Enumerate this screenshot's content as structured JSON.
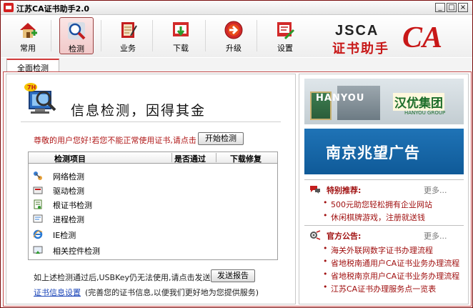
{
  "window": {
    "title": "江苏CA证书助手2.0",
    "controls": [
      "_",
      "□",
      "×"
    ]
  },
  "toolbar": {
    "items": [
      {
        "label": "常用",
        "icon": "home-icon"
      },
      {
        "label": "检测",
        "icon": "magnifier-icon",
        "active": true
      },
      {
        "label": "业务",
        "icon": "notebook-icon"
      },
      {
        "label": "下载",
        "icon": "download-icon"
      },
      {
        "label": "升级",
        "icon": "upgrade-icon"
      },
      {
        "label": "设置",
        "icon": "settings-icon"
      }
    ]
  },
  "logo": {
    "brand": "JSCA",
    "name": "证书助手",
    "mark": "CA"
  },
  "tabs": [
    {
      "label": "全面检测"
    }
  ],
  "check": {
    "hero_badge": "7H",
    "hero_title": "信息检测，因得其金",
    "prompt": "尊敬的用户您好!若您不能正常使用证书,请点击",
    "start_button": "开始检测",
    "columns": [
      "检测项目",
      "是否通过",
      "下载修复"
    ],
    "items": [
      {
        "label": "网络检测",
        "icon": "network-icon"
      },
      {
        "label": "驱动检测",
        "icon": "driver-icon"
      },
      {
        "label": "根证书检测",
        "icon": "certificate-icon"
      },
      {
        "label": "进程检测",
        "icon": "process-icon"
      },
      {
        "label": "IE检测",
        "icon": "ie-icon"
      },
      {
        "label": "相关控件检测",
        "icon": "control-icon"
      }
    ],
    "hint": "如上述检测通过后,USBKey仍无法使用,请点击发送报告",
    "send_button": "发送报告",
    "info_link": "证书信息设置",
    "info_note": "(完善您的证书信息,以便我们更好地为您提供服务)"
  },
  "ads": {
    "ad1": {
      "en": "HANYOU",
      "cn": "汉优集团",
      "sub": "HANYOU GROUP"
    },
    "ad2": {
      "text": "南京兆望广告"
    }
  },
  "recommend": {
    "title": "特别推荐:",
    "more": "更多...",
    "items": [
      "500元助您轻松拥有企业网站",
      "休闲棋牌游戏，注册就送钱"
    ]
  },
  "notice": {
    "title": "官方公告:",
    "more": "更多...",
    "items": [
      "海关外联网数字证书办理流程",
      "省地税南通用户CA证书业务办理流程",
      "省地税南京用户CA证书业务办理流程",
      "江苏CA证书办理服务点一览表"
    ]
  },
  "colors": {
    "accent": "#c81818",
    "frame": "#b00d0d",
    "link": "#1a44b8"
  }
}
